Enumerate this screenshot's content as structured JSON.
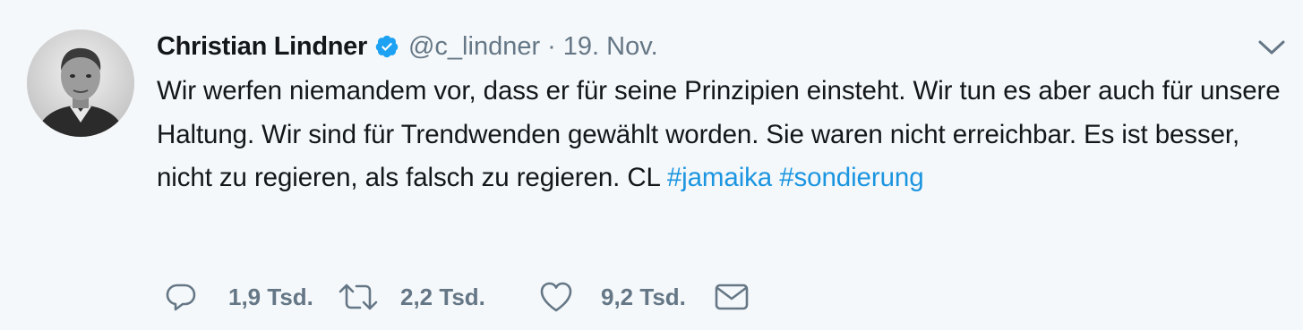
{
  "tweet": {
    "author_name": "Christian Lindner",
    "verified_icon": "verified-badge-icon",
    "handle": "@c_lindner",
    "separator": "·",
    "date": "19. Nov.",
    "text_before": "Wir werfen niemandem vor, dass er für seine Prinzipien einsteht. Wir tun es aber auch für unsere Haltung. Wir sind für Trendwenden gewählt worden. Sie waren nicht erreichbar. Es ist besser, nicht zu regieren, als falsch zu regieren. CL ",
    "hashtag_1": "#jamaika",
    "hashtag_2": "#sondierung",
    "accent_color": "#1b95e0",
    "muted_color": "#657786"
  },
  "actions": {
    "reply": {
      "icon": "reply-icon",
      "count": "1,9 Tsd."
    },
    "retweet": {
      "icon": "retweet-icon",
      "count": "2,2 Tsd."
    },
    "like": {
      "icon": "heart-icon",
      "count": "9,2 Tsd."
    },
    "message": {
      "icon": "envelope-icon"
    }
  },
  "menu": {
    "icon": "chevron-down-icon"
  }
}
